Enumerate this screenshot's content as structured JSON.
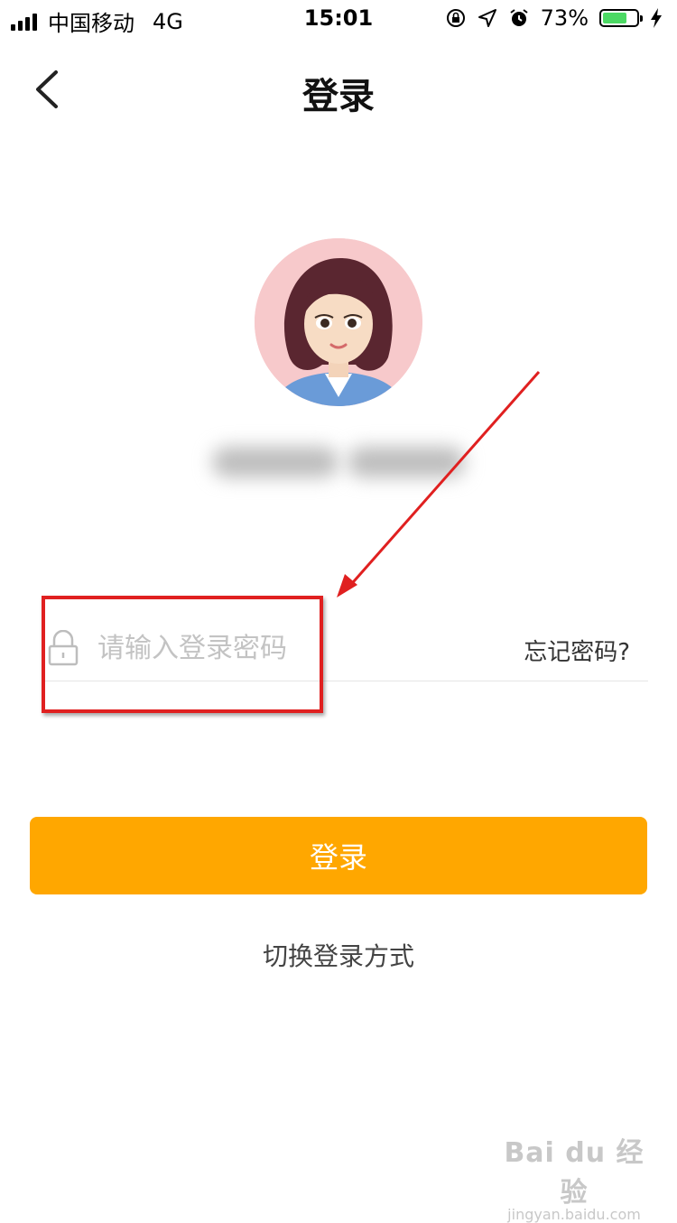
{
  "status_bar": {
    "carrier": "中国移动",
    "network": "4G",
    "time": "15:01",
    "battery_percent": "73%",
    "battery_level": 0.73,
    "battery_color": "#4cd964",
    "icons": [
      "signal-icon",
      "orientation-lock-icon",
      "location-icon",
      "alarm-icon",
      "battery-icon",
      "charging-icon"
    ]
  },
  "nav": {
    "title": "登录",
    "back_icon": "chevron-left-icon"
  },
  "profile": {
    "avatar_icon": "avatar-cartoon-woman",
    "avatar_bg": "#f7c9cb"
  },
  "password": {
    "placeholder": "请输入登录密码",
    "value": "",
    "icon": "lock-icon",
    "forgot_label": "忘记密码?"
  },
  "actions": {
    "login_label": "登录",
    "login_color": "#ffa700",
    "switch_label": "切换登录方式"
  },
  "annotation": {
    "highlight_color": "#e02020"
  },
  "watermark": {
    "main": "Bai du 经验",
    "sub": "jingyan.baidu.com"
  }
}
